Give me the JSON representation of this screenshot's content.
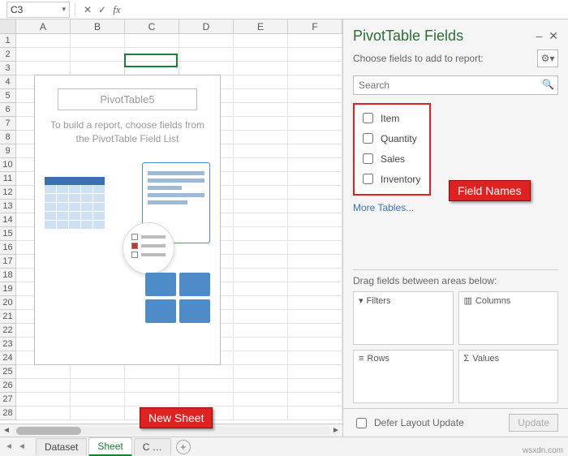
{
  "namebox": {
    "value": "C3",
    "cancel": "✕",
    "confirm": "✓",
    "fx": "fx"
  },
  "columns": [
    "A",
    "B",
    "C",
    "D",
    "E",
    "F"
  ],
  "row_count": 28,
  "pivot_placeholder": {
    "title": "PivotTable5",
    "msg1": "To build a report, choose fields from",
    "msg2": "the PivotTable Field List"
  },
  "tabs": {
    "nav_first": "◄",
    "nav_prev": "◄",
    "items": [
      "Dataset",
      "Sheet",
      "C …"
    ],
    "active_index": 1,
    "add": "+"
  },
  "panel": {
    "title": "PivotTable Fields",
    "dash": "–",
    "close": "✕",
    "subtitle": "Choose fields to add to report:",
    "gear": "⚙",
    "search_placeholder": "Search",
    "search_icon": "🔍",
    "fields": [
      "Item",
      "Quantity",
      "Sales",
      "Inventory"
    ],
    "more_tables": "More Tables...",
    "drag_label": "Drag fields between areas below:",
    "areas": {
      "filters": {
        "icon": "▾",
        "label": "Filters"
      },
      "columns": {
        "icon": "▥",
        "label": "Columns"
      },
      "rows": {
        "icon": "≡",
        "label": "Rows"
      },
      "values": {
        "icon": "Σ",
        "label": "Values"
      }
    },
    "defer_label": "Defer Layout Update",
    "update_btn": "Update"
  },
  "callouts": {
    "field": "Field Names",
    "sheet": "New Sheet"
  },
  "watermark": "wsxdn.com"
}
